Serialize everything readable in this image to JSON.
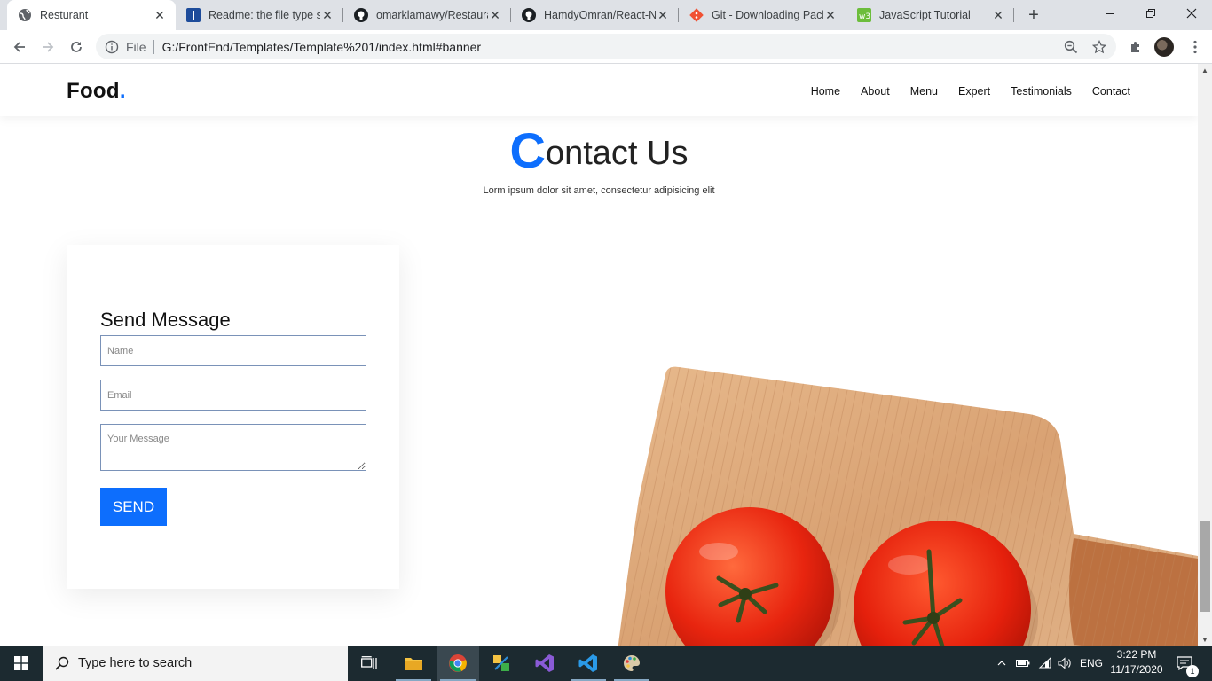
{
  "browser": {
    "tabs": [
      {
        "title": "Resturant",
        "favicon": "globe-icon"
      },
      {
        "title": "Readme: the file type si",
        "favicon": "readme-icon"
      },
      {
        "title": "omarklamawy/Restaura",
        "favicon": "github-icon"
      },
      {
        "title": "HamdyOmran/React-Na",
        "favicon": "github-icon"
      },
      {
        "title": "Git - Downloading Pack",
        "favicon": "git-icon"
      },
      {
        "title": "JavaScript Tutorial",
        "favicon": "w3schools-icon"
      }
    ],
    "address": {
      "scheme_label": "File",
      "url": "G:/FrontEnd/Templates/Template%201/index.html#banner"
    }
  },
  "site": {
    "logo": "Food",
    "logo_dot": ".",
    "nav": [
      "Home",
      "About",
      "Menu",
      "Expert",
      "Testimonials",
      "Contact"
    ],
    "section_title_first": "C",
    "section_title_rest": "ontact Us",
    "section_subtitle": "Lorm ipsum dolor sit amet, consectetur adipisicing elit",
    "form": {
      "heading": "Send Message",
      "name_placeholder": "Name",
      "email_placeholder": "Email",
      "message_placeholder": "Your Message",
      "send_label": "SEND"
    }
  },
  "taskbar": {
    "search_placeholder": "Type here to search",
    "language": "ENG",
    "time": "3:22 PM",
    "date": "11/17/2020",
    "notification_count": "1"
  },
  "colors": {
    "accent": "#0d6efd",
    "taskbar": "#1c2a30"
  }
}
